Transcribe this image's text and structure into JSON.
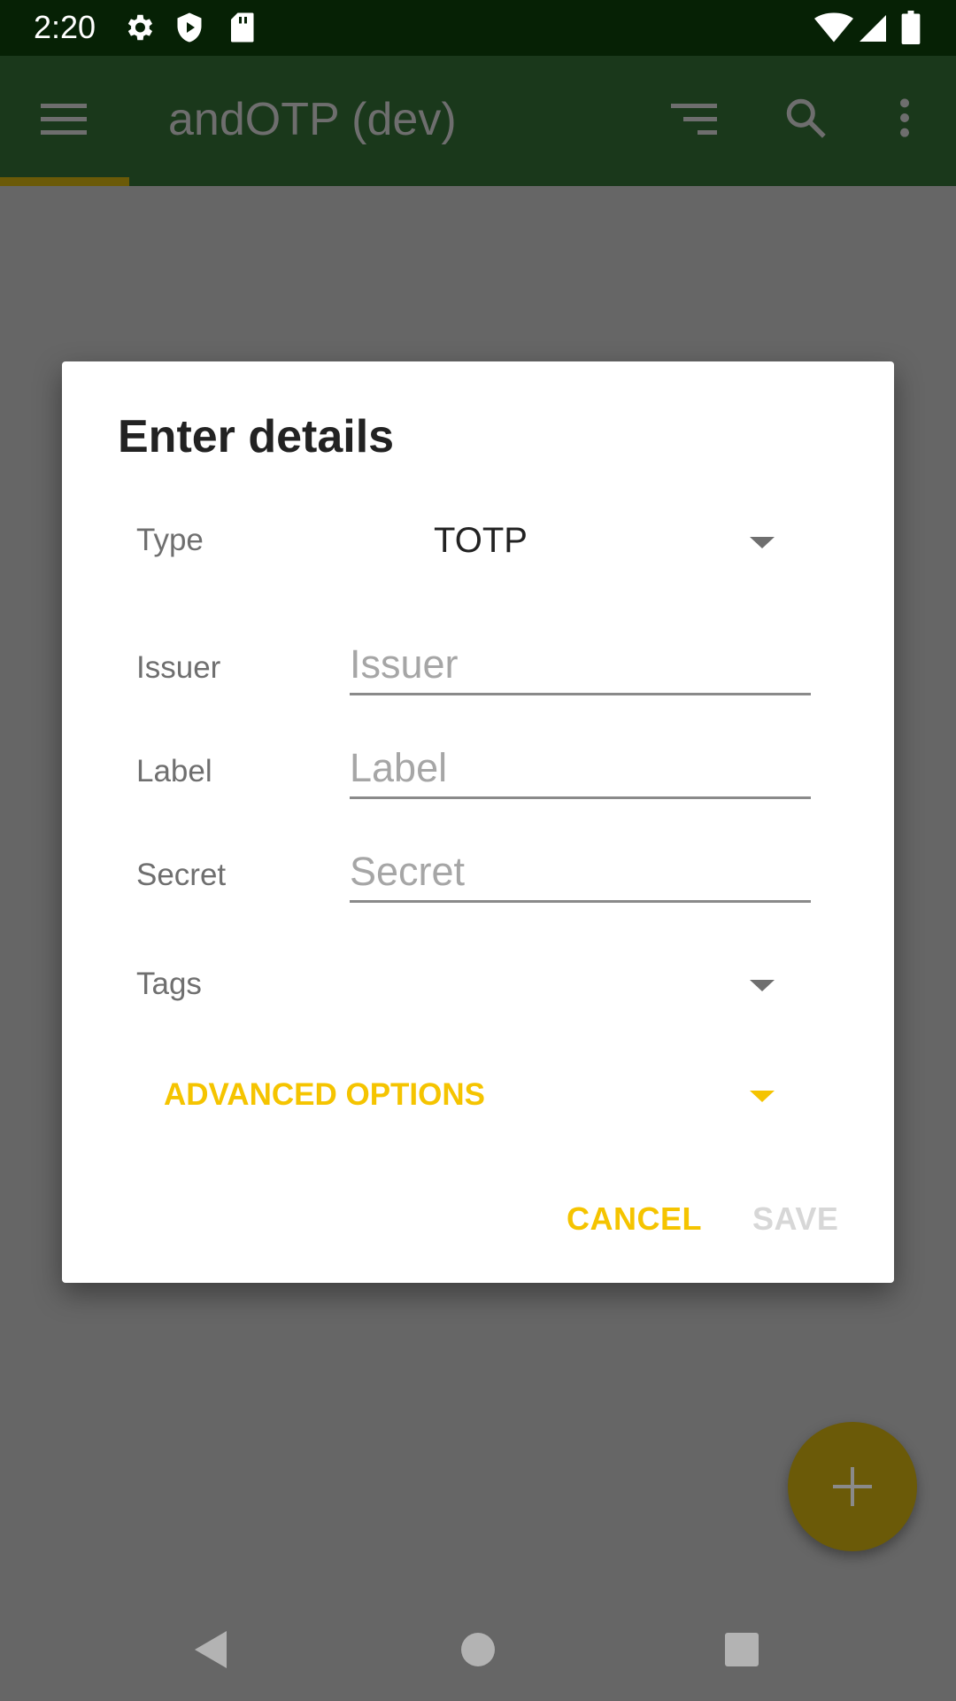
{
  "status_bar": {
    "time": "2:20",
    "icons": [
      "gear-icon",
      "shield-play-icon",
      "sd-card-icon",
      "wifi-icon",
      "signal-icon",
      "battery-icon"
    ]
  },
  "app_bar": {
    "title": "andOTP (dev)",
    "icons": [
      "menu-icon",
      "sort-icon",
      "search-icon",
      "more-vert-icon"
    ]
  },
  "dialog": {
    "title": "Enter details",
    "type_label": "Type",
    "type_value": "TOTP",
    "issuer_label": "Issuer",
    "issuer_placeholder": "Issuer",
    "label_label": "Label",
    "label_placeholder": "Label",
    "secret_label": "Secret",
    "secret_placeholder": "Secret",
    "tags_label": "Tags",
    "advanced_options": "ADVANCED OPTIONS",
    "cancel": "CANCEL",
    "save": "SAVE"
  },
  "colors": {
    "accent": "#f5c400",
    "status_bar": "#062105",
    "app_bar": "#1a381b",
    "scrim": "#666666",
    "fab": "#6b5a08",
    "save_disabled": "#d7d7d7"
  },
  "fab": {
    "icon": "plus-icon"
  },
  "nav_bar": {
    "icons": [
      "back-icon",
      "home-icon",
      "recents-icon"
    ]
  }
}
